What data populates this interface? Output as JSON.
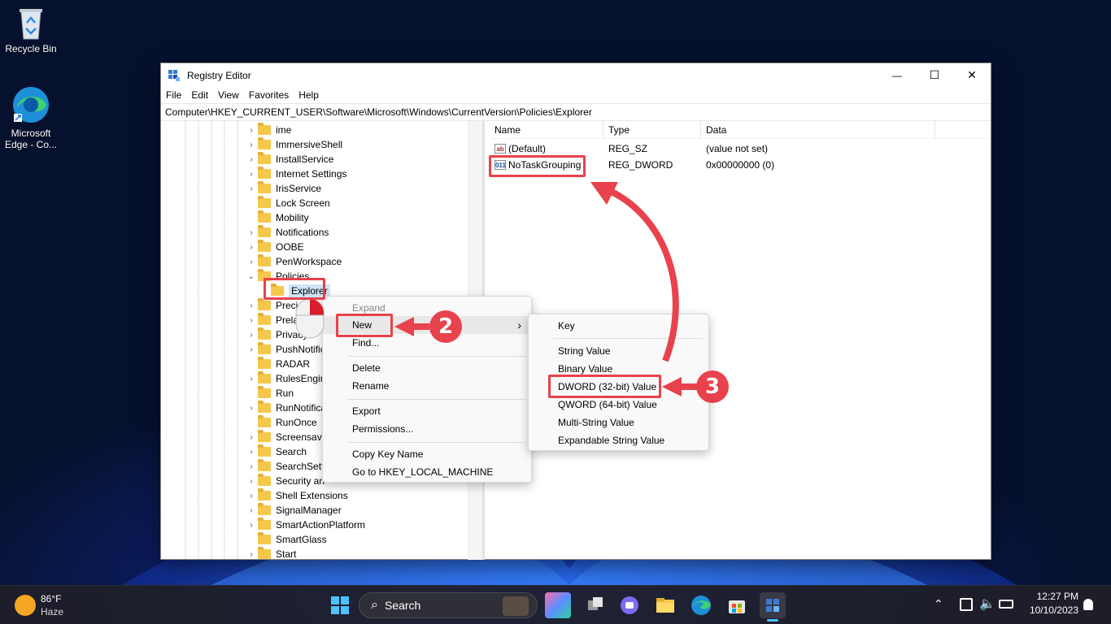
{
  "desktop": {
    "icons": [
      {
        "label": "Recycle Bin"
      },
      {
        "label_line1": "Microsoft",
        "label_line2": "Edge - Co..."
      }
    ]
  },
  "window": {
    "title": "Registry Editor",
    "controls": {
      "minimize": "—",
      "maximize": "☐",
      "close": "✕"
    },
    "menu": [
      "File",
      "Edit",
      "View",
      "Favorites",
      "Help"
    ],
    "address": "Computer\\HKEY_CURRENT_USER\\Software\\Microsoft\\Windows\\CurrentVersion\\Policies\\Explorer"
  },
  "tree": {
    "items": [
      {
        "label": "ime",
        "expander": "›"
      },
      {
        "label": "ImmersiveShell",
        "expander": "›"
      },
      {
        "label": "InstallService",
        "expander": "›"
      },
      {
        "label": "Internet Settings",
        "expander": "›"
      },
      {
        "label": "IrisService",
        "expander": "›"
      },
      {
        "label": "Lock Screen",
        "expander": ""
      },
      {
        "label": "Mobility",
        "expander": ""
      },
      {
        "label": "Notifications",
        "expander": "›"
      },
      {
        "label": "OOBE",
        "expander": "›"
      },
      {
        "label": "PenWorkspace",
        "expander": "›"
      },
      {
        "label": "Policies",
        "expander": "⌄"
      },
      {
        "label": "Explorer",
        "expander": "",
        "child": true,
        "selected": true
      },
      {
        "label": "Precisi",
        "expander": "›"
      },
      {
        "label": "Prelau",
        "expander": "›"
      },
      {
        "label": "Privacy",
        "expander": "›"
      },
      {
        "label": "PushNotific",
        "expander": "›"
      },
      {
        "label": "RADAR",
        "expander": ""
      },
      {
        "label": "RulesEngin",
        "expander": "›"
      },
      {
        "label": "Run",
        "expander": ""
      },
      {
        "label": "RunNotifica",
        "expander": "›"
      },
      {
        "label": "RunOnce",
        "expander": ""
      },
      {
        "label": "Screensave",
        "expander": "›"
      },
      {
        "label": "Search",
        "expander": "›"
      },
      {
        "label": "SearchSetti",
        "expander": "›"
      },
      {
        "label": "Security an",
        "expander": "›"
      },
      {
        "label": "Shell Extensions",
        "expander": "›"
      },
      {
        "label": "SignalManager",
        "expander": "›"
      },
      {
        "label": "SmartActionPlatform",
        "expander": "›"
      },
      {
        "label": "SmartGlass",
        "expander": ""
      },
      {
        "label": "Start",
        "expander": "›"
      }
    ]
  },
  "values_list": {
    "headers": {
      "name": "Name",
      "type": "Type",
      "data": "Data"
    },
    "rows": [
      {
        "icon": "ab",
        "name": "(Default)",
        "type": "REG_SZ",
        "data": "(value not set)"
      },
      {
        "icon": "011",
        "name": "NoTaskGrouping",
        "type": "REG_DWORD",
        "data": "0x00000000 (0)"
      }
    ]
  },
  "context_menu": {
    "items": [
      "Expand",
      "New",
      "Find...",
      "Delete",
      "Rename",
      "Export",
      "Permissions...",
      "Copy Key Name",
      "Go to HKEY_LOCAL_MACHINE"
    ],
    "submenu_arrow": "›"
  },
  "new_submenu": {
    "items": [
      "Key",
      "String Value",
      "Binary Value",
      "DWORD (32-bit) Value",
      "QWORD (64-bit) Value",
      "Multi-String Value",
      "Expandable String Value"
    ]
  },
  "annotations": {
    "step2": "2",
    "step3": "3",
    "color": "#e8424c"
  },
  "taskbar": {
    "weather": {
      "temp": "86°F",
      "condition": "Haze"
    },
    "search_label": "Search",
    "clock": {
      "time": "12:27 PM",
      "date": "10/10/2023"
    },
    "tray_arrow": "⌃"
  }
}
